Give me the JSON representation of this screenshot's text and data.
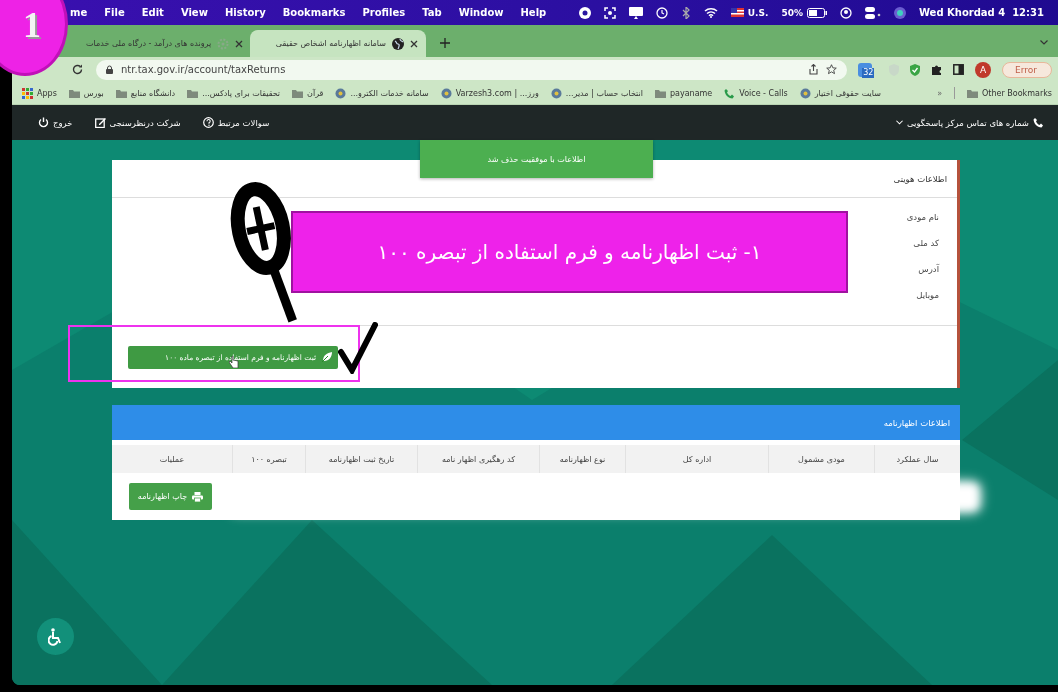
{
  "menu_bar": {
    "app_menus": [
      "Help",
      "Window",
      "Tab",
      "Profiles",
      "Bookmarks",
      "History",
      "View",
      "Edit",
      "File",
      "me"
    ],
    "input_source": "U.S.",
    "battery": "50%",
    "clock": "Wed Khordad 4  12:31"
  },
  "tabs": [
    {
      "title": "سامانه اظهارنامه اشخاص حقیقی",
      "selected": true
    },
    {
      "title": "پرونده های درآمد - درگاه ملی خدمات",
      "selected": false
    }
  ],
  "address_bar": {
    "url": "ntr.tax.gov.ir/account/taxReturns",
    "extension_badge": "32",
    "profile_initial": "A",
    "status_button": "Error"
  },
  "bookmarks": [
    {
      "label": "سایت حقوقی اختیار",
      "kind": "site"
    },
    {
      "label": "Voice - Calls",
      "kind": "phone"
    },
    {
      "label": "payaname",
      "kind": "folder"
    },
    {
      "label": "انتخاب حساب | مدیر...",
      "kind": "site"
    },
    {
      "label": "ورز... | Varzesh3.com",
      "kind": "site"
    },
    {
      "label": "سامانه خدمات الکترو...",
      "kind": "site"
    },
    {
      "label": "قرآن",
      "kind": "folder"
    },
    {
      "label": "تحقیقات برای پادکس...",
      "kind": "folder"
    },
    {
      "label": "دانشگاه منابع",
      "kind": "folder"
    },
    {
      "label": "بورس",
      "kind": "folder"
    },
    {
      "label": "Apps",
      "kind": "apps"
    }
  ],
  "bookmarks_overflow": "»",
  "other_bookmarks": "Other Bookmarks",
  "site_nav": {
    "contact": "شماره های تماس مرکز پاسخگویی",
    "links": [
      {
        "label": "سوالات مرتبط",
        "kind": "help"
      },
      {
        "label": "شرکت درنظرسنجی",
        "kind": "edit"
      },
      {
        "label": "خروج",
        "kind": "power"
      }
    ]
  },
  "toast": "اطلاعات با موفقیت حذف شد",
  "identity_card": {
    "title": "اطلاعات هویتی",
    "fields": [
      "نام مودی",
      "کد ملی",
      "آدرس",
      "موبایل"
    ],
    "action_button": "ثبت اظهارنامه و فرم استفاده از تبصره ماده ۱۰۰"
  },
  "returns_card": {
    "title": "اطلاعات اظهارنامه",
    "columns": [
      "سال عملکرد",
      "مودی مشمول",
      "اداره کل",
      "نوع اظهارنامه",
      "کد رهگیری اظهار نامه",
      "تاریخ ثبت اظهارنامه",
      "تبصره ۱۰۰",
      "عملیات"
    ],
    "print_button": "چاپ اظهارنامه"
  },
  "annotation": {
    "step_badge": "1",
    "caption": "۱- ثبت اظهارنامه و فرم استفاده از تبصره ۱۰۰"
  }
}
